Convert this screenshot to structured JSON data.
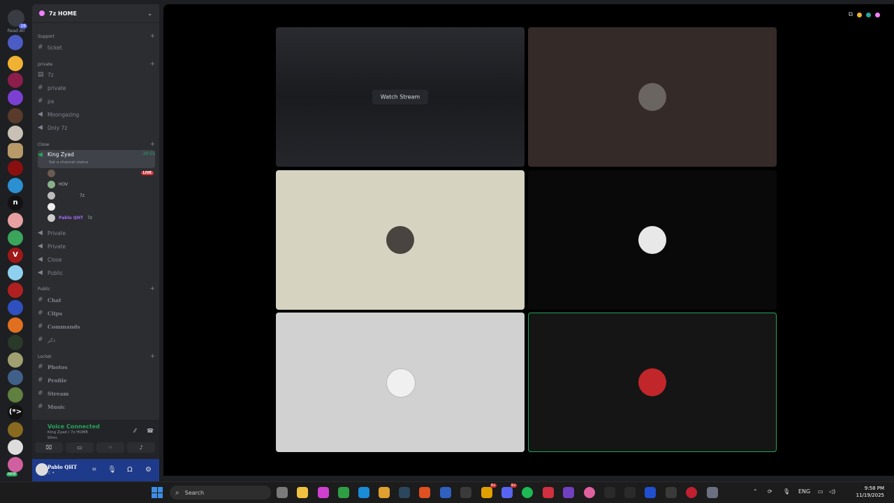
{
  "server_rail": {
    "home_badge": "28",
    "read_all": "Read All",
    "new_badge": "NEW"
  },
  "sidebar": {
    "server_name": "7z HOME",
    "categories": {
      "support": "Support",
      "private": "private",
      "close": "Close",
      "public": "Public",
      "locket": "Locket"
    },
    "channels": {
      "ticket": "ticket",
      "ch_7z": "7z",
      "private": "private",
      "pa": "pa",
      "moongazing": "Moongazing",
      "only7z": "Only 7z",
      "king_zyad": "King Zyad",
      "king_zyad_time": "20:55",
      "king_zyad_status": "Set a channel status",
      "private2": "Private",
      "private3": "Private",
      "close": "Close",
      "public": "Public",
      "chat": "Chat",
      "clips": "Clips",
      "commands": "Commands",
      "dhikr": "ذكر",
      "photos": "Photos",
      "profile": "Profile",
      "stream": "Stream",
      "music": "Music"
    },
    "voice_users": {
      "live_badge": "LIVE",
      "user2": "HOV",
      "user3_tag": "7z",
      "user5": "Pablo QHT",
      "user5_tag": "7z"
    },
    "voice_panel": {
      "title": "Voice Connected",
      "subtitle": "King Zyad / 7z HOME",
      "ping": "93ms"
    },
    "user_panel": {
      "name": "Pablo QHT"
    }
  },
  "stage": {
    "watch_stream": "Watch Stream"
  },
  "taskbar": {
    "search_placeholder": "Search",
    "lang": "ENG",
    "time": "9:58 PM",
    "date": "11/19/2025",
    "badge_9plus": "9+"
  }
}
